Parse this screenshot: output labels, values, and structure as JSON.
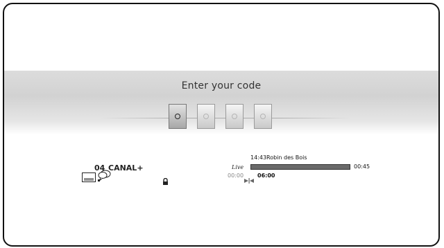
{
  "code_entry": {
    "title": "Enter your code",
    "digits_total": 4,
    "active_digit": 1
  },
  "channel": {
    "number": "04",
    "name": "CANAL+",
    "icons": [
      "subtitles-icon",
      "audio-language-icon",
      "lock-icon"
    ]
  },
  "program": {
    "time": "14:43",
    "title": "Robin des Bois",
    "live_label": "Live",
    "progress": 1.0,
    "end_time": "00:45",
    "start_time": "00:00",
    "marker_time": "06:00"
  },
  "colors": {
    "band": "#d6d6d6",
    "progress_fill": "#6a6a6a",
    "active_box": "#b0b0b0"
  }
}
